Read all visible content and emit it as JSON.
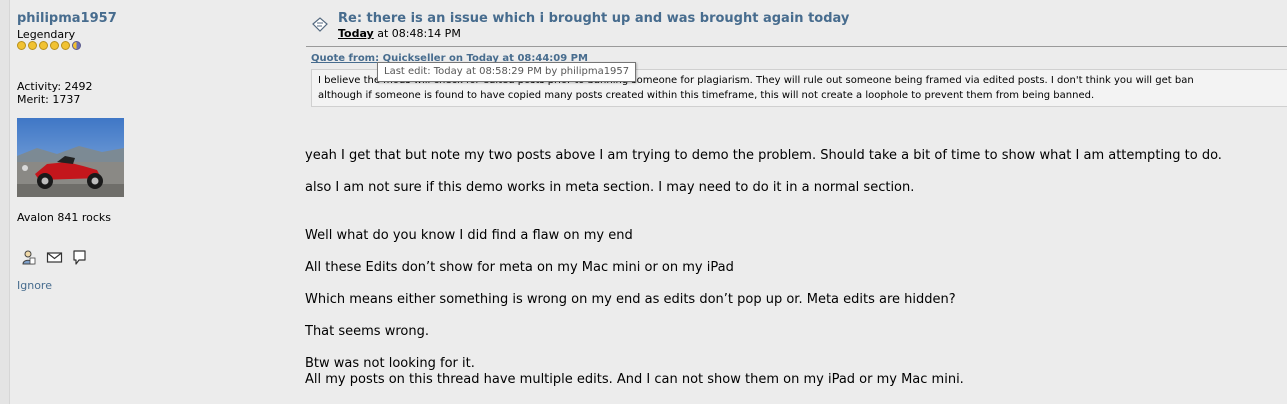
{
  "poster": {
    "username": "philipma1957",
    "rank": "Legendary",
    "activity": "Activity: 2492",
    "merit": "Merit: 1737",
    "signature": "Avalon 841 rocks",
    "ignore_label": "Ignore",
    "icons": [
      "profile-icon",
      "email-icon",
      "personal-message-icon"
    ]
  },
  "post": {
    "subject": "Re: there is an issue which i brought up and was brought again today",
    "date_prefix": "Today",
    "date_time": " at 08:48:14 PM",
    "quote_header": "Quote from: Quickseller on Today at 08:44:09 PM",
    "quote_lines": [
      "I believe the mods will check for edited posts prior to banning someone for plagiarism. They will rule out someone being framed via edited posts. I don't think you will get ban",
      "although if someone is found to have copied many posts created within this timeframe, this will not create a loophole to prevent them from being banned."
    ],
    "tooltip": "Last edit: Today at 08:58:29 PM by philipma1957",
    "body_lines": [
      "yeah  I get that  but  note  my  two posts above I am trying to demo the problem.  Should take a bit of time to show what  I am attempting to do.",
      "also I am not sure if this demo works in meta section.  I may need to do it in a normal section.",
      "Well what do you know I did find a flaw on my end",
      "All these Edits don’t show for meta on my Mac mini or on my iPad",
      "Which means either something is wrong on my end as edits don’t pop up or. Meta edits are hidden?",
      "That seems wrong.",
      "Btw was not looking for it.",
      "All my posts on this thread have multiple edits. And I can not show them on my iPad or my Mac mini."
    ]
  },
  "colors": {
    "link": "#476c8e",
    "background": "#ececec",
    "quote_background": "#f3f3f3"
  }
}
